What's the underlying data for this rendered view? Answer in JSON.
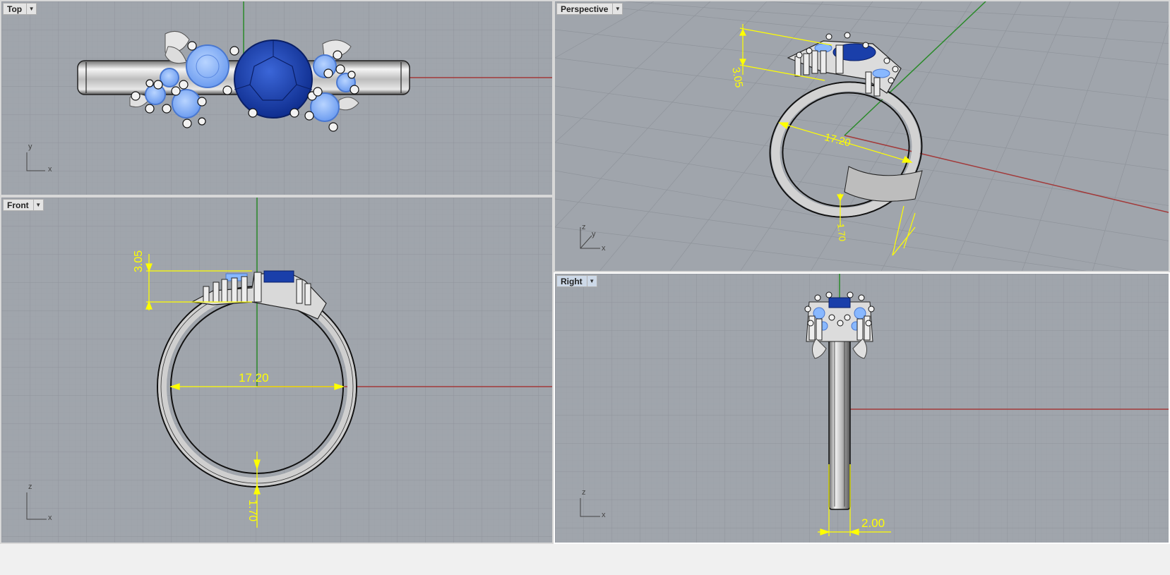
{
  "viewports": {
    "top": {
      "label": "Top",
      "axis": {
        "a": "y",
        "b": "x"
      }
    },
    "perspective": {
      "label": "Perspective",
      "axis": {
        "a": "z",
        "b": "y",
        "c": "x"
      },
      "dims": {
        "height": "3.05",
        "diameter": "17.20",
        "thickness": "1.70"
      }
    },
    "front": {
      "label": "Front",
      "axis": {
        "a": "z",
        "b": "x"
      },
      "dims": {
        "height": "3.05",
        "diameter": "17.20",
        "thickness": "1.70"
      }
    },
    "right": {
      "label": "Right",
      "axis": {
        "a": "z",
        "b": "x"
      },
      "dims": {
        "width": "2.00"
      }
    }
  },
  "colors": {
    "viewport_bg": "#9fa4ab",
    "grid": "#8d9299",
    "axis_x": "#a23a3a",
    "axis_y": "#2a8a2a",
    "dimension": "#ffff00",
    "main_stone": "#1a3faa",
    "side_stone": "#88b8ff",
    "metal": "#d0d0d0"
  }
}
